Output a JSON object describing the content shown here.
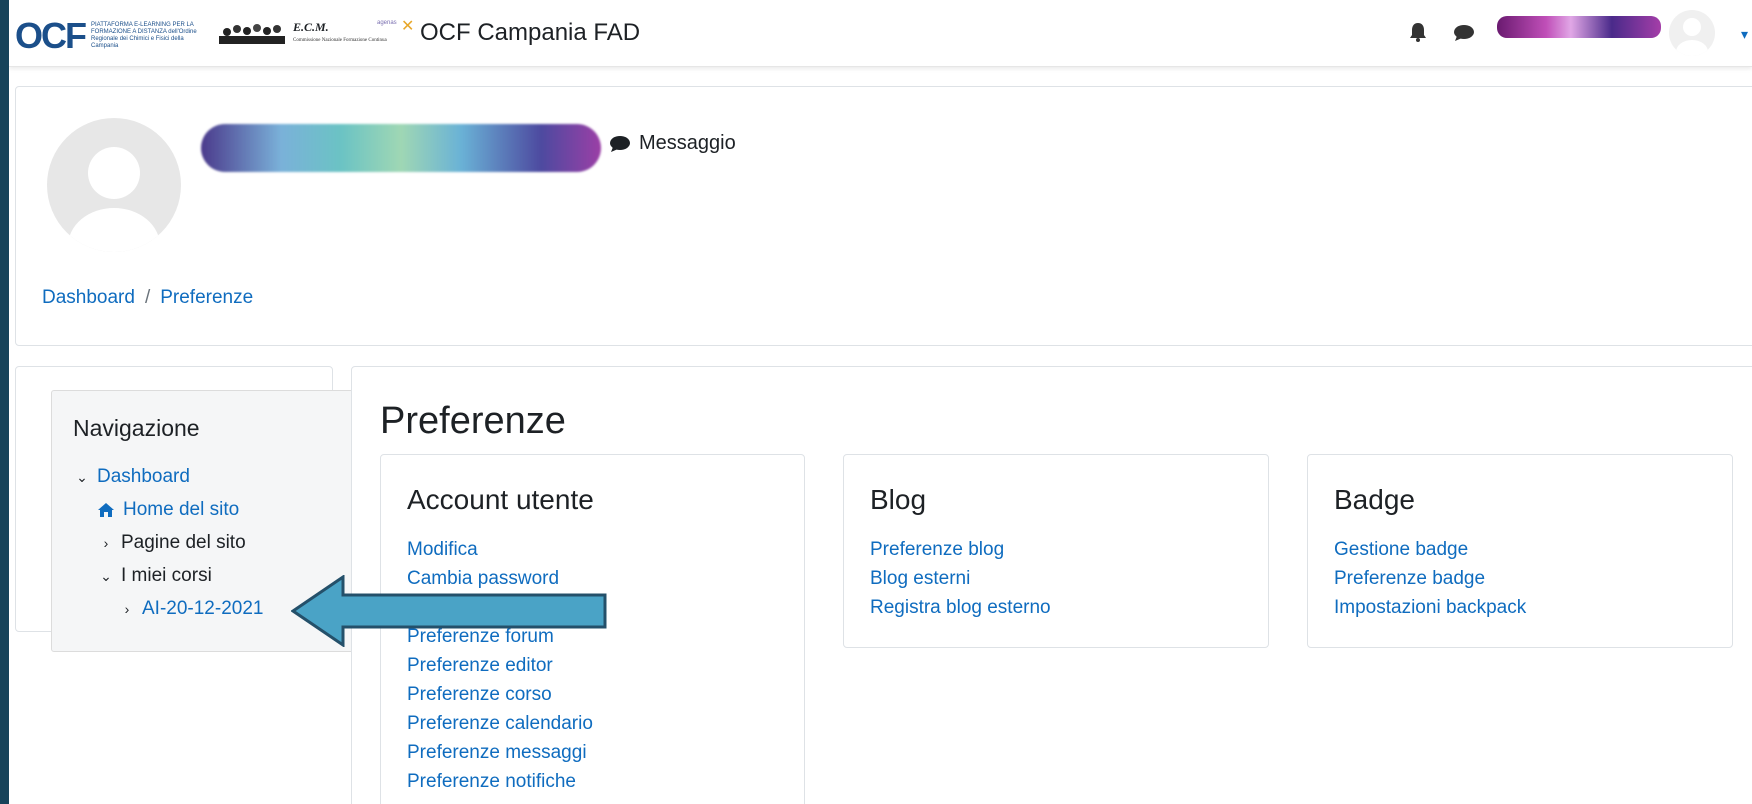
{
  "navbar": {
    "logo_text": "OCF",
    "logo_tagline": "PIATTAFORMA E-LEARNING PER LA FORMAZIONE A DISTANZA dell'Ordine Regionale dei Chimici e Fisici della Campania",
    "ecm_title": "E.C.M.",
    "ecm_subtitle": "Commissione Nazionale Formazione Continua",
    "agenas": "agenas",
    "site_name": "OCF Campania FAD",
    "icons": [
      "bell-icon",
      "chat-icon",
      "chevron-down-icon"
    ]
  },
  "profile": {
    "message_label": "Messaggio"
  },
  "breadcrumb": {
    "items": [
      "Dashboard",
      "Preferenze"
    ],
    "separator": "/"
  },
  "navigation": {
    "title": "Navigazione",
    "items": [
      {
        "label": "Dashboard",
        "icon": "chevron-down-icon"
      },
      {
        "label": "Home del sito",
        "icon": "home-icon"
      },
      {
        "label": "Pagine del sito",
        "icon": "chevron-right-icon"
      },
      {
        "label": "I miei corsi",
        "icon": "chevron-down-icon"
      },
      {
        "label": "AI-20-12-2021",
        "icon": "chevron-right-icon"
      }
    ]
  },
  "main": {
    "page_title": "Preferenze",
    "cards": [
      {
        "title": "Account utente",
        "links": [
          "Modifica",
          "Cambia password",
          "Preferenze forum",
          "Preferenze editor",
          "Preferenze corso",
          "Preferenze calendario",
          "Preferenze messaggi",
          "Preferenze notifiche"
        ]
      },
      {
        "title": "Blog",
        "links": [
          "Preferenze blog",
          "Blog esterni",
          "Registra blog esterno"
        ]
      },
      {
        "title": "Badge",
        "links": [
          "Gestione badge",
          "Preferenze badge",
          "Impostazioni backpack"
        ]
      }
    ]
  },
  "colors": {
    "link": "#0f6cbf",
    "frame": "#17435a",
    "arrow": "#4aa3c6"
  }
}
